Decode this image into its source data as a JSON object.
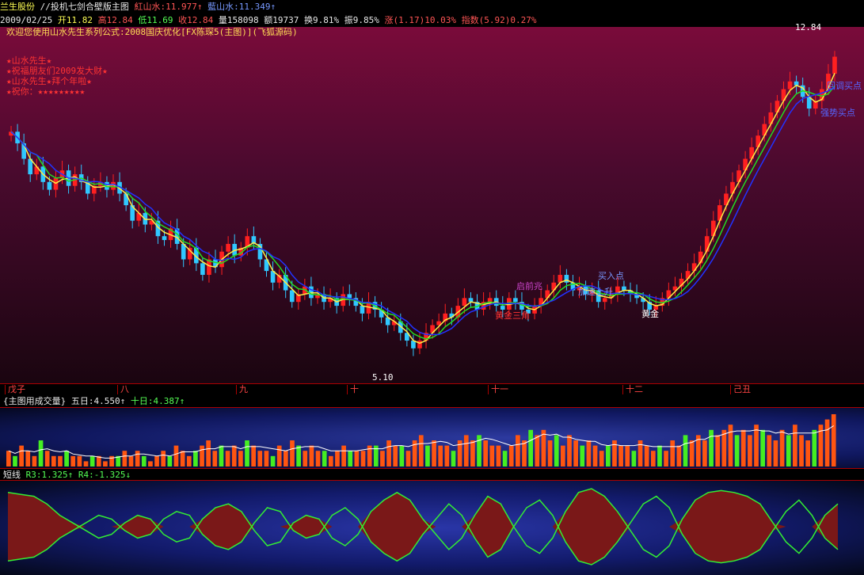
{
  "header": {
    "stock_name": "兰生股份",
    "formula_title": "//投机七剑合壁版主图",
    "red_line": "紅山水:11.977",
    "red_arrow": "↑",
    "blue_line": "藍山水:11.349",
    "blue_arrow": "↑",
    "date": "2009/02/25",
    "open": "开11.82",
    "high": "高12.84",
    "low": "低11.69",
    "close": "收12.84",
    "volume": "量158098",
    "amount": "额19737",
    "turnover": "换9.81%",
    "amplitude": "振9.85%",
    "change": "涨(1.17)10.03%",
    "index": "指数(5.92)0.27%"
  },
  "main": {
    "banner": "欢迎您使用山水先生系列公式:2008国庆优化[FX陈琛5(主图)](飞狐源码)",
    "price_top": "12.84",
    "low_price": "5.10",
    "overlay_lines": [
      "★山水先生★",
      "★祝福朋友们2009发大财★",
      "★山水先生★拜个年啦★",
      "★祝你：★★★★★★★★★"
    ],
    "annotations": {
      "gold_triangle": "黄金三角",
      "launch": "启前兆",
      "gold": "黄金",
      "buy_point": "买入点",
      "up": "加速上升",
      "right1": "回调买点",
      "right2": "强势买点"
    }
  },
  "axis": {
    "labels": [
      "戊子",
      "八",
      "九",
      "十",
      "十一",
      "十二",
      "己丑"
    ]
  },
  "volume_panel": {
    "title": "{主图用成交量}",
    "ma5": "五日:4.550",
    "ma5_arrow": "↑",
    "ma10": "十日:4.387",
    "ma10_arrow": "↑"
  },
  "osc_panel": {
    "title": "短线",
    "r3": "R3:1.325",
    "r3_arrow": "↑",
    "r4": "R4:-1.325",
    "r4_arrow": "↓"
  },
  "chart_data": {
    "type": "candlestick",
    "ylim": [
      4.6,
      13.2
    ],
    "candles_close": [
      10.9,
      10.6,
      10.2,
      9.8,
      10.0,
      9.6,
      9.4,
      9.7,
      9.9,
      9.5,
      9.8,
      9.6,
      9.3,
      9.5,
      9.6,
      9.4,
      9.6,
      9.3,
      9.0,
      8.6,
      8.8,
      8.5,
      8.6,
      8.2,
      8.1,
      8.4,
      8.0,
      7.6,
      7.9,
      7.5,
      7.2,
      7.6,
      7.4,
      7.8,
      8.0,
      7.7,
      7.9,
      8.2,
      8.0,
      7.6,
      7.3,
      7.0,
      7.2,
      6.8,
      6.5,
      6.7,
      6.9,
      6.6,
      6.7,
      6.5,
      6.6,
      6.4,
      6.7,
      6.6,
      6.4,
      6.2,
      6.5,
      6.3,
      6.1,
      5.9,
      6.0,
      5.7,
      5.5,
      5.3,
      5.5,
      5.7,
      5.9,
      6.0,
      6.2,
      6.1,
      6.4,
      6.6,
      6.5,
      6.3,
      6.5,
      6.6,
      6.4,
      6.3,
      6.6,
      6.5,
      6.3,
      6.2,
      6.4,
      6.6,
      6.8,
      7.0,
      7.2,
      7.0,
      6.8,
      6.9,
      6.7,
      6.8,
      6.5,
      6.6,
      6.7,
      6.9,
      6.8,
      6.7,
      6.6,
      6.5,
      6.3,
      6.4,
      6.6,
      6.8,
      6.9,
      7.1,
      7.3,
      7.5,
      7.8,
      8.2,
      8.6,
      9.0,
      9.3,
      9.6,
      9.9,
      10.2,
      10.5,
      10.8,
      11.1,
      11.4,
      11.7,
      12.0,
      12.2,
      12.1,
      11.8,
      11.5,
      11.7,
      12.0,
      12.4,
      12.84
    ],
    "volume": [
      3,
      2,
      4,
      3,
      2,
      5,
      3,
      2,
      2,
      3,
      2,
      2,
      1,
      2,
      2,
      1,
      2,
      2,
      3,
      2,
      3,
      2,
      1,
      2,
      3,
      2,
      4,
      3,
      2,
      3,
      4,
      5,
      3,
      4,
      3,
      4,
      3,
      5,
      4,
      3,
      3,
      2,
      4,
      3,
      5,
      4,
      3,
      4,
      3,
      3,
      2,
      3,
      4,
      3,
      3,
      3,
      4,
      4,
      3,
      5,
      4,
      4,
      3,
      5,
      6,
      4,
      5,
      4,
      4,
      3,
      5,
      6,
      5,
      6,
      5,
      4,
      4,
      3,
      4,
      6,
      5,
      7,
      6,
      7,
      5,
      6,
      4,
      6,
      5,
      4,
      5,
      4,
      3,
      4,
      5,
      4,
      4,
      3,
      5,
      4,
      3,
      4,
      3,
      5,
      4,
      6,
      5,
      6,
      5,
      7,
      6,
      7,
      8,
      6,
      7,
      6,
      8,
      7,
      6,
      5,
      7,
      6,
      8,
      6,
      5,
      7,
      8,
      9,
      10
    ],
    "osc": [
      0.9,
      0.85,
      0.8,
      0.6,
      0.3,
      0.1,
      -0.1,
      -0.3,
      -0.2,
      0.1,
      0.3,
      0.2,
      -0.2,
      -0.4,
      -0.3,
      0.2,
      0.5,
      0.6,
      0.4,
      -0.1,
      -0.5,
      -0.4,
      0.1,
      0.3,
      0.2,
      -0.3,
      -0.5,
      -0.2,
      0.4,
      0.7,
      0.9,
      0.7,
      0.2,
      -0.2,
      -0.6,
      -0.3,
      0.3,
      0.8,
      0.6,
      0.0,
      -0.5,
      -0.7,
      -0.3,
      0.4,
      0.9,
      1.0,
      0.8,
      0.4,
      -0.1,
      -0.6,
      -0.8,
      -0.5,
      0.2,
      0.7,
      0.9,
      0.95,
      0.9,
      0.8,
      0.6,
      0.1,
      -0.4,
      -0.7,
      -0.3,
      0.3,
      0.6
    ]
  }
}
